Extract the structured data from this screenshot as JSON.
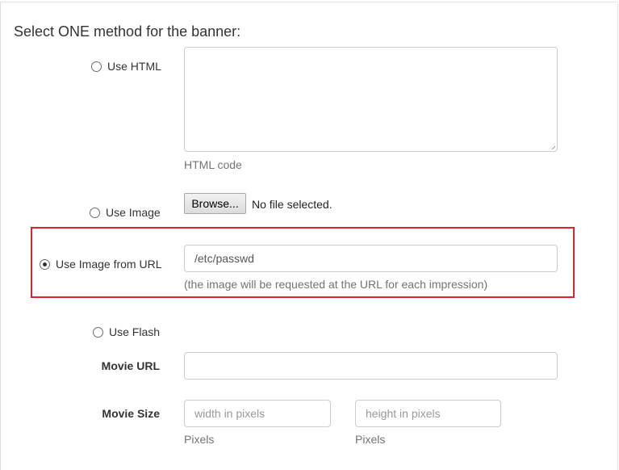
{
  "heading": "Select ONE method for the banner:",
  "methods": {
    "html": {
      "label": "Use HTML",
      "checked": false,
      "help": "HTML code"
    },
    "image": {
      "label": "Use Image",
      "checked": false,
      "browse_label": "Browse...",
      "file_status": "No file selected."
    },
    "image_url": {
      "label": "Use Image from URL",
      "checked": true,
      "value": "/etc/passwd",
      "help": "(the image will be requested at the URL for each impression)"
    },
    "flash": {
      "label": "Use Flash",
      "checked": false
    }
  },
  "movie_url": {
    "label": "Movie URL",
    "value": ""
  },
  "movie_size": {
    "label": "Movie Size",
    "width_placeholder": "width in pixels",
    "height_placeholder": "height in pixels",
    "width_unit": "Pixels",
    "height_unit": "Pixels"
  },
  "colors": {
    "highlight": "#e0232a",
    "border": "#cccccc",
    "help_text": "#737373"
  }
}
